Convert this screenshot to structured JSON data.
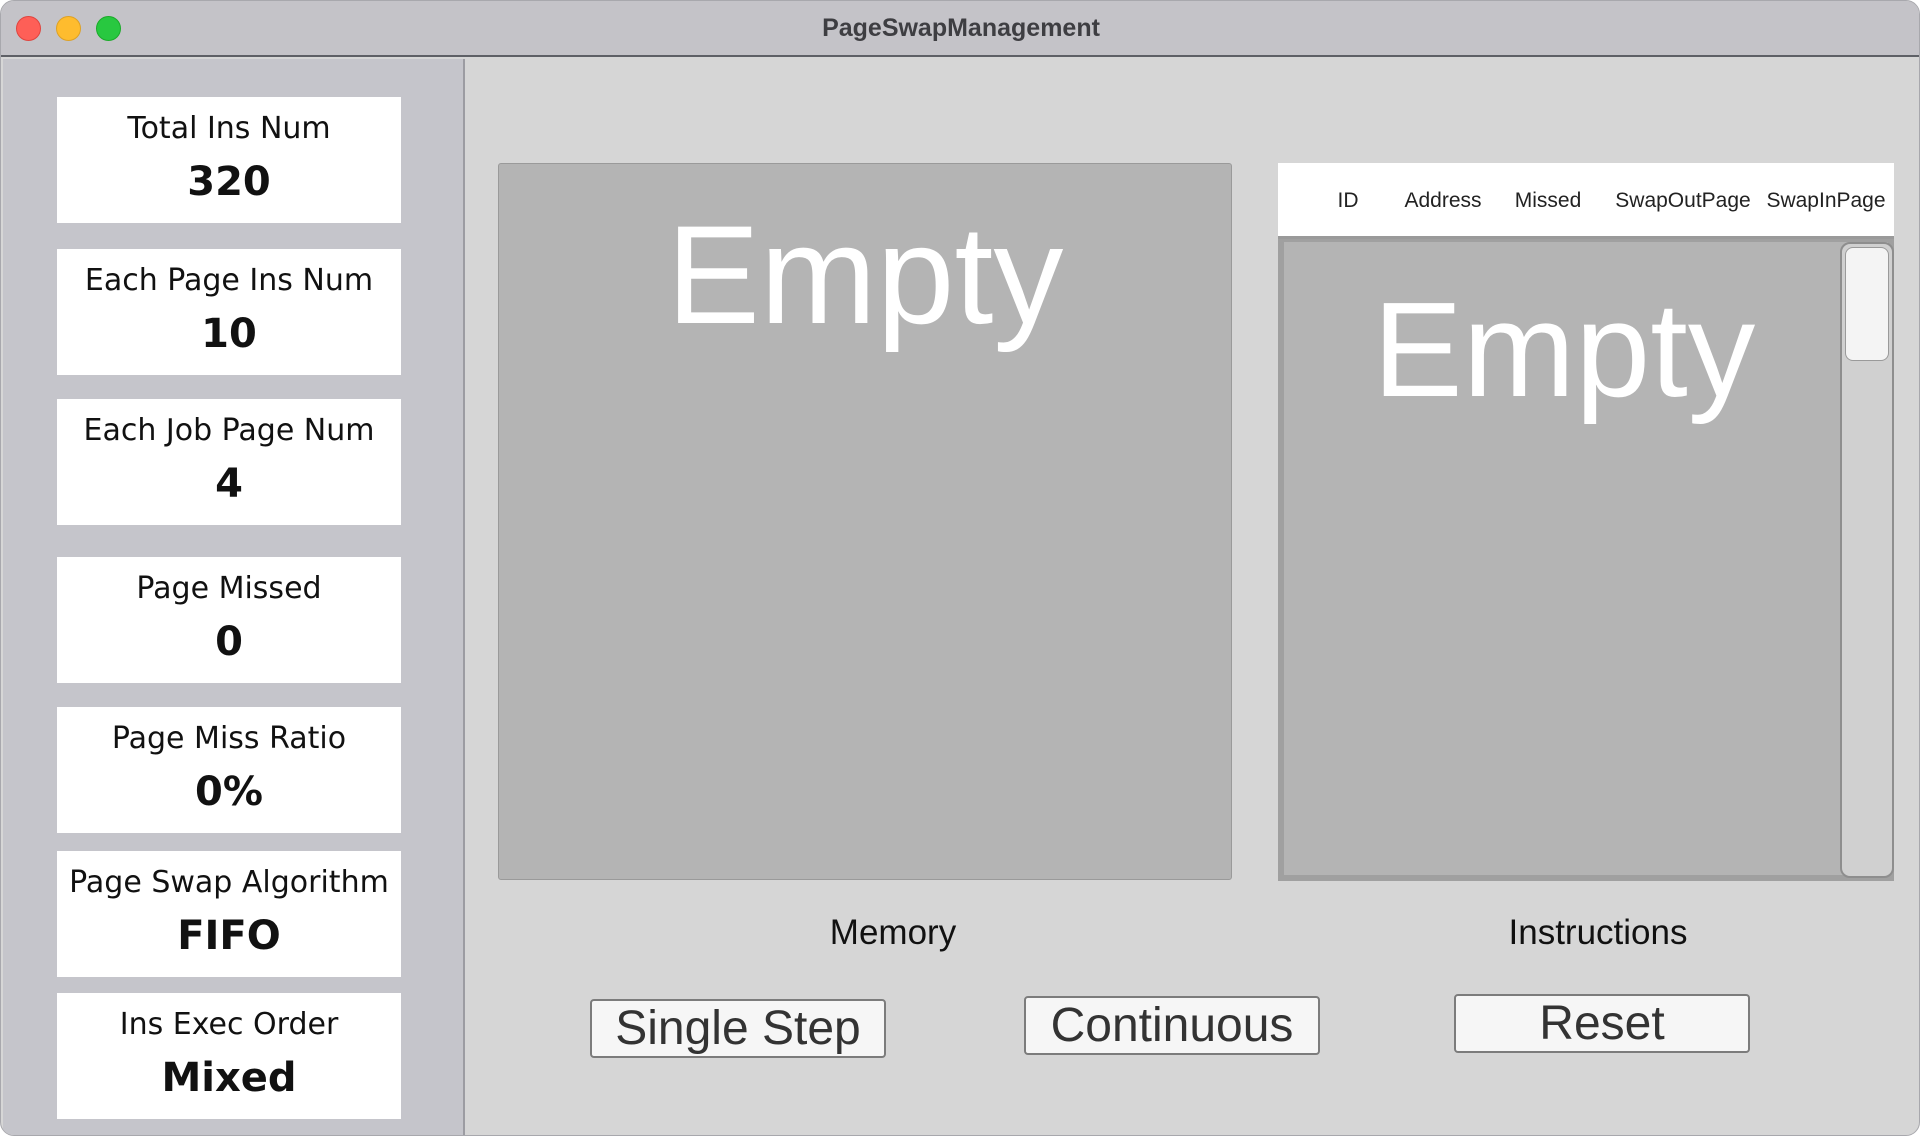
{
  "window": {
    "title": "PageSwapManagement"
  },
  "sidebar": {
    "stats": [
      {
        "label": "Total Ins Num",
        "value": "320"
      },
      {
        "label": "Each Page Ins Num",
        "value": "10"
      },
      {
        "label": "Each Job Page Num",
        "value": "4"
      },
      {
        "label": "Page Missed",
        "value": "0"
      },
      {
        "label": "Page Miss Ratio",
        "value": "0%"
      },
      {
        "label": "Page Swap Algorithm",
        "value": "FIFO"
      },
      {
        "label": "Ins Exec Order",
        "value": "Mixed"
      }
    ]
  },
  "memory": {
    "placeholder": "Empty",
    "caption": "Memory"
  },
  "instructions": {
    "columns": [
      "ID",
      "Address",
      "Missed",
      "SwapOutPage",
      "SwapInPage"
    ],
    "placeholder": "Empty",
    "caption": "Instructions"
  },
  "buttons": {
    "single_step": "Single Step",
    "continuous": "Continuous",
    "reset": "Reset"
  },
  "colors": {
    "close": "#fe5f57",
    "minimize": "#febc2e",
    "maximize": "#28c840",
    "panel_gray": "#b4b4b4"
  }
}
